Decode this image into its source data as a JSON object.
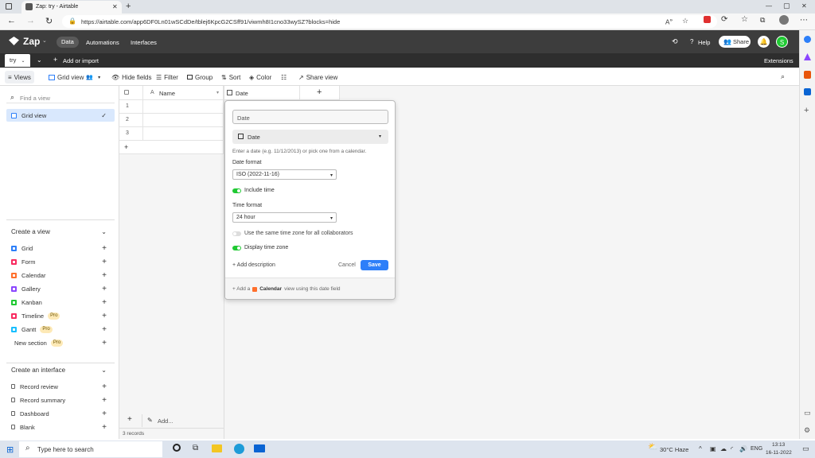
{
  "browser": {
    "tab_title": "Zap: try - Airtable",
    "url": "https://airtable.com/app6DF0Ln01wSCdDe/tblej6KpcG2CSff91/viwmh8I1cno33wySZ?blocks=hide",
    "window_controls": [
      "—",
      "▢",
      "✕"
    ]
  },
  "app": {
    "name": "Zap",
    "nav": [
      "Data",
      "Automations",
      "Interfaces"
    ],
    "help_label": "Help",
    "share_label": "Share",
    "avatar_letter": "S",
    "accent": "#2d7ff9"
  },
  "table_bar": {
    "table_name": "try",
    "add_import_label": "Add or import",
    "extensions_label": "Extensions"
  },
  "toolbar": {
    "views_label": "Views",
    "grid_view_label": "Grid view",
    "hide_fields": "Hide fields",
    "filter": "Filter",
    "group": "Group",
    "sort": "Sort",
    "color": "Color",
    "share_view": "Share view"
  },
  "sidebar": {
    "find_placeholder": "Find a view",
    "active_view": "Grid view",
    "create_view_title": "Create a view",
    "create_view_items": [
      {
        "label": "Grid",
        "color": "#2d7ff9",
        "pro": ""
      },
      {
        "label": "Form",
        "color": "#f82b60",
        "pro": ""
      },
      {
        "label": "Calendar",
        "color": "#ff6f2c",
        "pro": ""
      },
      {
        "label": "Gallery",
        "color": "#8b46ff",
        "pro": ""
      },
      {
        "label": "Kanban",
        "color": "#20c933",
        "pro": ""
      },
      {
        "label": "Timeline",
        "color": "#f82b60",
        "pro": "Pro"
      },
      {
        "label": "Gantt",
        "color": "#18bfff",
        "pro": "Pro"
      },
      {
        "label": "New section",
        "color": "",
        "pro": "Pro"
      }
    ],
    "create_interface_title": "Create an interface",
    "interface_items": [
      "Record review",
      "Record summary",
      "Dashboard",
      "Blank"
    ]
  },
  "grid": {
    "col_name": "Name",
    "col_date": "Date",
    "rows": [
      "1",
      "2",
      "3"
    ],
    "add_label": "Add...",
    "record_count": "3 records"
  },
  "popup": {
    "field_name": "Date",
    "field_type": "Date",
    "hint": "Enter a date (e.g. 11/12/2013) or pick one from a calendar.",
    "date_format_label": "Date format",
    "date_format_value": "ISO (2022-11-16)",
    "include_time": "Include time",
    "time_format_label": "Time format",
    "time_format_value": "24 hour",
    "same_tz": "Use the same time zone for all collaborators",
    "display_tz": "Display time zone",
    "add_description": "+ Add description",
    "cancel": "Cancel",
    "save": "Save",
    "footer_prefix": "+ Add a",
    "footer_link": "Calendar",
    "footer_suffix": "view using this date field"
  },
  "taskbar": {
    "search_placeholder": "Type here to search",
    "weather": "30°C  Haze",
    "lang": "ENG",
    "time": "13:13",
    "date": "16-11-2022"
  }
}
